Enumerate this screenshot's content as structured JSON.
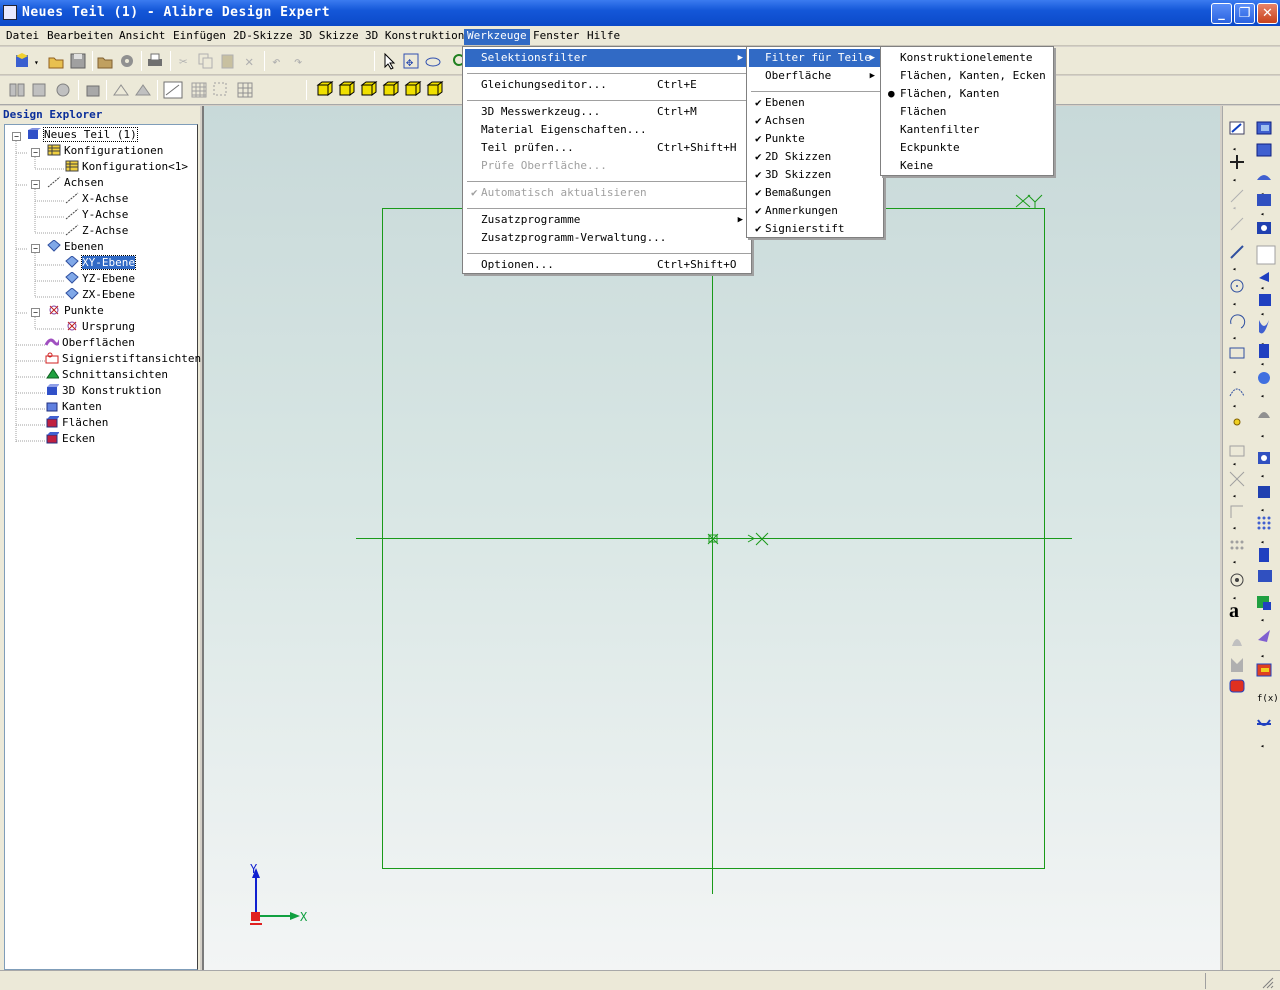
{
  "window": {
    "title": "Neues Teil (1) - Alibre Design Expert"
  },
  "menubar": [
    "Datei",
    "Bearbeiten",
    "Ansicht",
    "Einfügen",
    "2D-Skizze",
    "3D Skizze",
    "3D Konstruktion",
    "Werkzeuge",
    "Fenster",
    "Hilfe"
  ],
  "explorer": {
    "header": "Design Explorer",
    "tree": {
      "root": "Neues Teil (1)",
      "konfigurationen": "Konfigurationen",
      "konfiguration1": "Konfiguration<1>",
      "achsen": "Achsen",
      "x_achse": "X-Achse",
      "y_achse": "Y-Achse",
      "z_achse": "Z-Achse",
      "ebenen": "Ebenen",
      "xy_ebene": "XY-Ebene",
      "yz_ebene": "YZ-Ebene",
      "zx_ebene": "ZX-Ebene",
      "punkte": "Punkte",
      "ursprung": "Ursprung",
      "oberflaechen": "Oberflächen",
      "signierstiftansichten": "Signierstiftansichten",
      "schnittansichten": "Schnittansichten",
      "konstruktion3d": "3D Konstruktion",
      "kanten": "Kanten",
      "flaechen": "Flächen",
      "ecken": "Ecken"
    }
  },
  "werkzeuge_menu": {
    "selektionsfilter": "Selektionsfilter",
    "gleichungseditor": "Gleichungseditor...",
    "gleichungseditor_key": "Ctrl+E",
    "messwerkzeug": "3D Messwerkzeug...",
    "messwerkzeug_key": "Ctrl+M",
    "material": "Material Eigenschaften...",
    "teil_pruefen": "Teil prüfen...",
    "teil_pruefen_key": "Ctrl+Shift+H",
    "pruefe_oberflaeche": "Prüfe Oberfläche...",
    "automatisch": "Automatisch aktualisieren",
    "zusatzprogramme": "Zusatzprogramme",
    "zusatzprogramm_verwaltung": "Zusatzprogramm-Verwaltung...",
    "optionen": "Optionen...",
    "optionen_key": "Ctrl+Shift+O"
  },
  "selektionsfilter_menu": {
    "filter_fuer_teile": "Filter für Teile",
    "oberflaeche": "Oberfläche",
    "ebenen": "Ebenen",
    "achsen": "Achsen",
    "punkte": "Punkte",
    "skizzen2d": "2D Skizzen",
    "skizzen3d": "3D Skizzen",
    "bemassungen": "Bemaßungen",
    "anmerkungen": "Anmerkungen",
    "signierstift": "Signierstift"
  },
  "filter_teile_menu": {
    "konstruktionselemente": "Konstruktionelemente",
    "flaechen_kanten_ecken": "Flächen, Kanten, Ecken",
    "flaechen_kanten": "Flächen, Kanten",
    "flaechen": "Flächen",
    "kantenfilter": "Kantenfilter",
    "eckpunkte": "Eckpunkte",
    "keine": "Keine"
  },
  "canvas": {
    "x_label": "X",
    "y_label": "Y",
    "sketch_color": "#1a9a1a"
  },
  "right_toolbar": {
    "fx_label": "f(x)",
    "text_tool": "a"
  }
}
